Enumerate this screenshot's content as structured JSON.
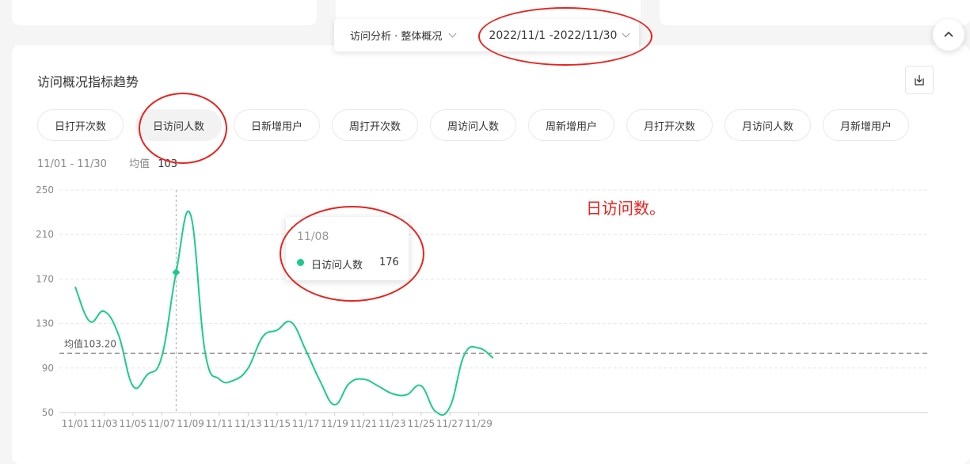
{
  "filter": {
    "analysis_label": "访问分析 · 整体概况",
    "date_range": "2022/11/1 -2022/11/30"
  },
  "section": {
    "title": "访问概况指标趋势"
  },
  "metric_tabs": [
    {
      "label": "日打开次数",
      "active": false
    },
    {
      "label": "日访问人数",
      "active": true
    },
    {
      "label": "日新增用户",
      "active": false
    },
    {
      "label": "周打开次数",
      "active": false
    },
    {
      "label": "周访问人数",
      "active": false
    },
    {
      "label": "周新增用户",
      "active": false
    },
    {
      "label": "月打开次数",
      "active": false
    },
    {
      "label": "月访问人数",
      "active": false
    },
    {
      "label": "月新增用户",
      "active": false
    }
  ],
  "summary": {
    "range": "11/01 - 11/30",
    "avg_label": "均值",
    "avg_value": "103"
  },
  "tooltip": {
    "date": "11/08",
    "series": "日访问人数",
    "value": "176"
  },
  "annotation": "日访问数。",
  "colors": {
    "line": "#1ccb8c",
    "annotation": "#e8231e",
    "mean_line": "#999999"
  },
  "chart_data": {
    "type": "line",
    "y_ticks": [
      "250",
      "210",
      "170",
      "130",
      "90",
      "50"
    ],
    "ylim": [
      50,
      250
    ],
    "x_tick_labels": [
      "11/01",
      "11/03",
      "11/05",
      "11/07",
      "11/09",
      "11/11",
      "11/13",
      "11/15",
      "11/17",
      "11/19",
      "11/21",
      "11/23",
      "11/25",
      "11/27",
      "11/29"
    ],
    "x": [
      "11/01",
      "11/02",
      "11/03",
      "11/04",
      "11/05",
      "11/06",
      "11/07",
      "11/08",
      "11/09",
      "11/10",
      "11/11",
      "11/12",
      "11/13",
      "11/14",
      "11/15",
      "11/16",
      "11/17",
      "11/18",
      "11/19",
      "11/20",
      "11/21",
      "11/22",
      "11/23",
      "11/24",
      "11/25",
      "11/26",
      "11/27",
      "11/28",
      "11/29",
      "11/30"
    ],
    "series": [
      {
        "name": "日访问人数",
        "values": [
          163,
          132,
          141,
          120,
          74,
          84,
          100,
          176,
          228,
          105,
          80,
          79,
          90,
          118,
          124,
          131,
          106,
          78,
          57,
          76,
          80,
          74,
          67,
          66,
          74,
          51,
          55,
          102,
          108,
          99
        ]
      }
    ],
    "mean_line": {
      "label": "均值103.20",
      "value": 103.2
    },
    "highlight_index": 7,
    "grid": true
  }
}
